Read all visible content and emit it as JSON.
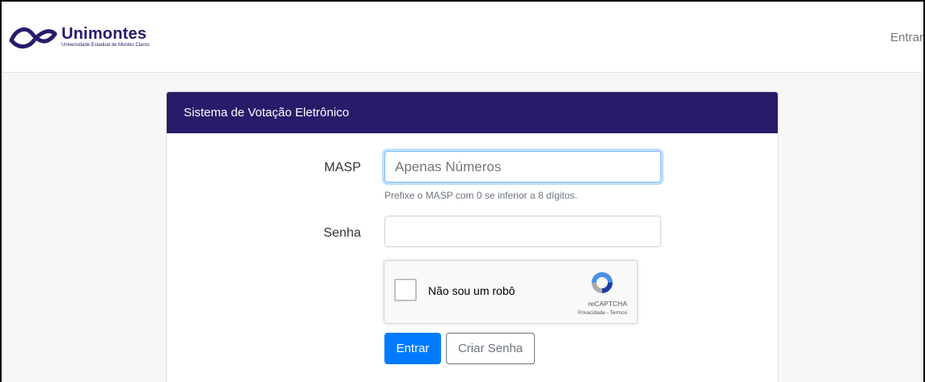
{
  "navbar": {
    "brand_name": "Unimontes",
    "brand_subtitle": "Universidade Estadual de Montes Claros",
    "login_link": "Entrar"
  },
  "card": {
    "title": "Sistema de Votação Eletrônico"
  },
  "form": {
    "masp_label": "MASP",
    "masp_placeholder": "Apenas Números",
    "masp_value": "",
    "masp_help": "Prefixe o MASP com 0 se inferior a 8 dígitos.",
    "senha_label": "Senha",
    "senha_value": ""
  },
  "recaptcha": {
    "label": "Não sou um robô",
    "brand": "reCAPTCHA",
    "links": "Privacidade - Termos",
    "checked": false
  },
  "buttons": {
    "entrar": "Entrar",
    "criar_senha": "Criar Senha"
  },
  "colors": {
    "header_bg": "#2a1a6a",
    "primary": "#007bff",
    "brand": "#2a1a6a"
  }
}
